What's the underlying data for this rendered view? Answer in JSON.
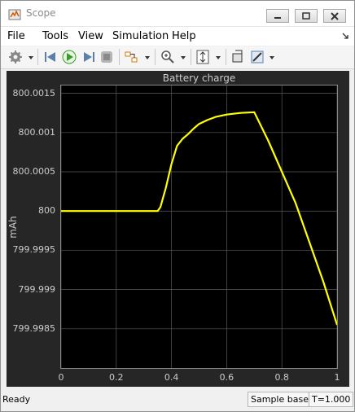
{
  "window": {
    "title": "Scope"
  },
  "menu": {
    "items": [
      "File",
      "Tools",
      "View",
      "Simulation",
      "Help"
    ]
  },
  "toolbar": {
    "icons": [
      "settings-icon",
      "step-back-icon",
      "run-icon",
      "step-forward-icon",
      "stop-icon",
      "signal-select-icon",
      "zoom-icon",
      "autoscale-icon",
      "highlight-block-icon",
      "style-icon"
    ]
  },
  "plot": {
    "title": "Battery charge",
    "ylabel": "mAh",
    "line_color": "#ffff00",
    "background": "#000000",
    "grid_color": "#5a5a5a"
  },
  "chart_data": {
    "type": "line",
    "title": "Battery charge",
    "xlabel": "",
    "ylabel": "mAh",
    "xlim": [
      0,
      1
    ],
    "ylim": [
      799.998,
      800.0016
    ],
    "xticks": [
      "0",
      "0.2",
      "0.4",
      "0.6",
      "0.8",
      "1"
    ],
    "yticks": [
      "800.0015",
      "800.001",
      "800.0005",
      "800",
      "799.9995",
      "799.999",
      "799.9985"
    ],
    "ytick_values": [
      800.0015,
      800.001,
      800.0005,
      800,
      799.9995,
      799.999,
      799.9985
    ],
    "xtick_values": [
      0,
      0.2,
      0.4,
      0.6,
      0.8,
      1
    ],
    "grid": true,
    "series": [
      {
        "x": [
          0,
          0.35,
          0.36,
          0.38,
          0.4,
          0.42,
          0.44,
          0.46,
          0.48,
          0.5,
          0.53,
          0.56,
          0.6,
          0.65,
          0.7,
          0.75,
          0.8,
          0.85,
          0.9,
          0.95,
          1.0
        ],
        "y": [
          800,
          800,
          800.00005,
          800.0003,
          800.0006,
          800.00083,
          800.00092,
          800.00098,
          800.00105,
          800.00111,
          800.00116,
          800.0012,
          800.00123,
          800.00125,
          800.00126,
          800.0009,
          800.0005,
          800.0001,
          799.9996,
          799.9991,
          799.99855
        ]
      }
    ]
  },
  "status": {
    "left": "Ready",
    "mode": "Sample based",
    "time": "T=1.000"
  }
}
